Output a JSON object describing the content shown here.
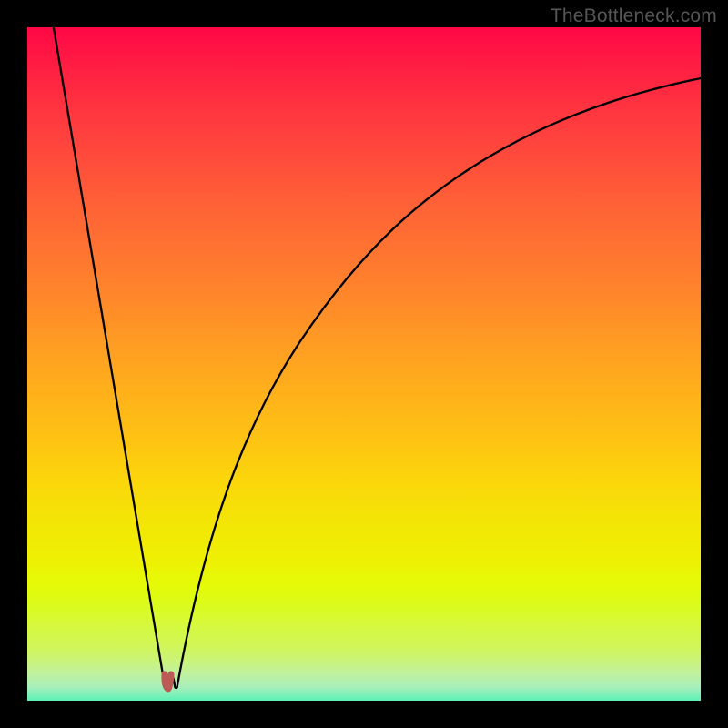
{
  "watermark": "TheBottleneck.com",
  "colors": {
    "frame": "#000000",
    "curve_stroke": "#000000",
    "bump_fill": "#bc5a55",
    "watermark_text": "#565656"
  },
  "chart_data": {
    "type": "line",
    "title": "",
    "xlabel": "",
    "ylabel": "",
    "xlim": [
      0,
      100
    ],
    "ylim": [
      0,
      100
    ],
    "grid": false,
    "gradient_stops": [
      {
        "pos": 0,
        "color": "#ff0745"
      },
      {
        "pos": 0.5,
        "color": "#ffa020"
      },
      {
        "pos": 0.78,
        "color": "#eef103"
      },
      {
        "pos": 0.93,
        "color": "#caf483"
      },
      {
        "pos": 1.0,
        "color": "#00f37a"
      }
    ],
    "series": [
      {
        "name": "bottleneck-curve",
        "x": [
          0.0,
          2.5,
          5.0,
          7.5,
          10.0,
          12.5,
          15.0,
          17.0,
          19.0,
          20.4,
          22.0,
          24.0,
          26.0,
          28.0,
          30.0,
          33.0,
          36.0,
          40.0,
          45.0,
          50.0,
          56.0,
          63.0,
          71.0,
          80.0,
          90.0,
          100.0
        ],
        "y": [
          100.0,
          88.0,
          75.5,
          63.0,
          50.5,
          38.0,
          25.5,
          15.6,
          6.5,
          2.3,
          3.1,
          10.8,
          18.2,
          25.0,
          31.2,
          39.4,
          46.3,
          53.8,
          61.2,
          67.0,
          72.4,
          77.2,
          81.4,
          85.0,
          88.2,
          90.8
        ]
      }
    ],
    "annotations": [
      {
        "name": "minimum-bump",
        "x": 20.4,
        "y": 2.3,
        "shape": "u",
        "color": "#bc5a55"
      }
    ]
  }
}
